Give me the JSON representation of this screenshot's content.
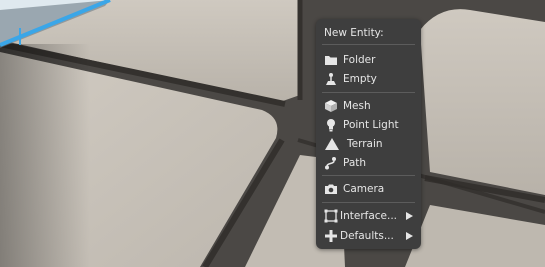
{
  "menu": {
    "title": "New Entity:",
    "groups": [
      [
        {
          "label": "Folder",
          "icon": "folder-icon"
        },
        {
          "label": "Empty",
          "icon": "empty-entity-icon"
        }
      ],
      [
        {
          "label": "Mesh",
          "icon": "mesh-cube-icon"
        },
        {
          "label": "Point Light",
          "icon": "lightbulb-icon"
        },
        {
          "label": "Terrain",
          "icon": "mountain-icon"
        },
        {
          "label": "Path",
          "icon": "path-icon"
        }
      ],
      [
        {
          "label": "Camera",
          "icon": "camera-icon"
        }
      ],
      [
        {
          "label": "Interface...",
          "icon": "interface-frame-icon",
          "submenu": true
        },
        {
          "label": "Defaults...",
          "icon": "plus-icon",
          "submenu": true
        }
      ]
    ],
    "colors": {
      "background": "#3e3e3e",
      "text": "#e6e6e6",
      "separator": "#5c5c5c"
    }
  },
  "scene": {
    "colors": {
      "tile": "#c7c1b8",
      "groove": "#3b3835",
      "accent_object": "#3aa6e8"
    }
  }
}
